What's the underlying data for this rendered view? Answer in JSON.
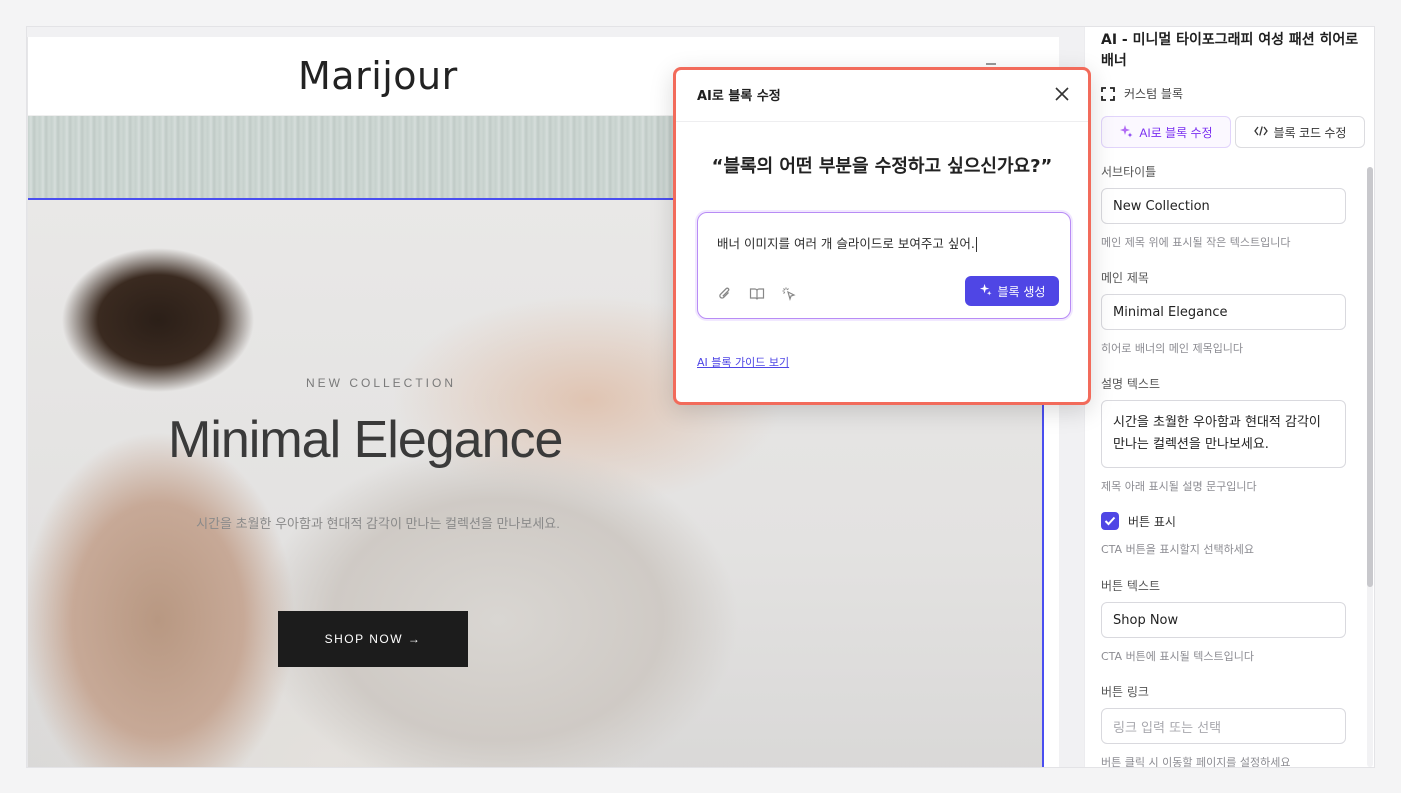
{
  "preview": {
    "logo": "Marijour",
    "hero": {
      "subtitle": "NEW COLLECTION",
      "title": "Minimal Elegance",
      "description": "시간을 초월한 우아함과 현대적 감각이 만나는 컬렉션을 만나보세요.",
      "button_label": "SHOP NOW →"
    }
  },
  "modal": {
    "title": "AI로 블록 수정",
    "question": "“블록의 어떤 부분을 수정하고 싶으신가요?”",
    "prompt_value": "배너 이미지를 여러 개 슬라이드로 보여주고 싶어.",
    "generate_label": "블록 생성",
    "guide_link": "AI 블록 가이드 보기"
  },
  "panel": {
    "title": "AI - 미니멀 타이포그래피 여성 패션 히어로 배너",
    "custom_block_label": "커스텀 블록",
    "tabs": [
      {
        "label": "AI로 블록 수정",
        "icon": "sparkle-icon",
        "active": true
      },
      {
        "label": "블록 코드 수정",
        "icon": "code-icon",
        "active": false
      }
    ],
    "fields": {
      "subtitle": {
        "label": "서브타이틀",
        "value": "New Collection",
        "help": "메인 제목 위에 표시될 작은 텍스트입니다"
      },
      "main_title": {
        "label": "메인 제목",
        "value": "Minimal Elegance",
        "help": "히어로 배너의 메인 제목입니다"
      },
      "description": {
        "label": "설명 텍스트",
        "value": "시간을 초월한 우아함과 현대적 감각이 만나는 컬렉션을 만나보세요.",
        "help": "제목 아래 표시될 설명 문구입니다"
      },
      "show_button": {
        "label": "버튼 표시",
        "checked": true,
        "help": "CTA 버튼을 표시할지 선택하세요"
      },
      "button_text": {
        "label": "버튼 텍스트",
        "value": "Shop Now",
        "help": "CTA 버튼에 표시될 텍스트입니다"
      },
      "button_link": {
        "label": "버튼 링크",
        "placeholder": "링크 입력 또는 선택",
        "help": "버튼 클릭 시 이동할 페이지를 설정하세요"
      }
    }
  },
  "colors": {
    "accent": "#4f46e5",
    "ai_purple": "#7a2ff0",
    "modal_border": "#f26b5b",
    "selection_outline": "#4a4ef0"
  }
}
